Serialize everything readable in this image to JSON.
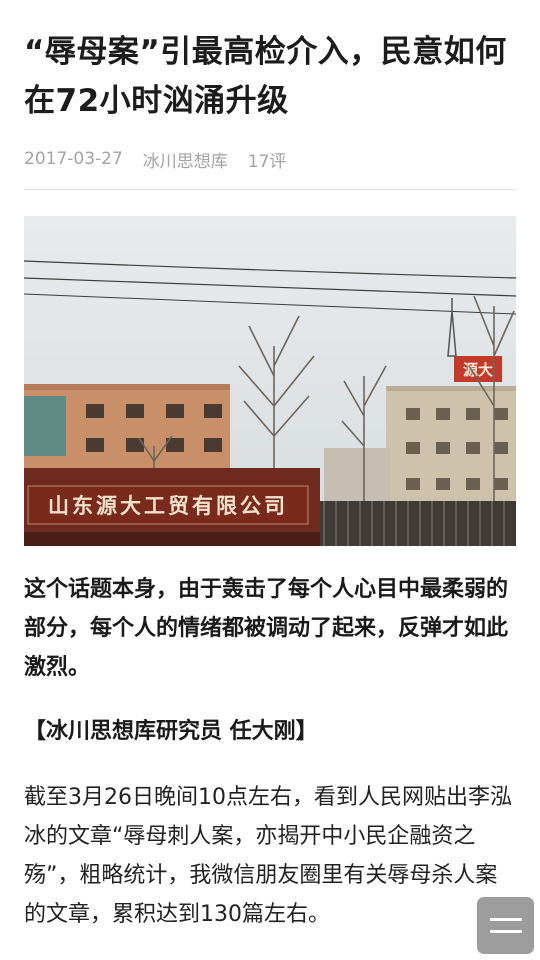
{
  "article": {
    "title": "“辱母案”引最高检介入，民意如何在72小时汹涌升级",
    "date": "2017-03-27",
    "source": "冰川思想库",
    "comments": "17评"
  },
  "photo": {
    "sign_text": "山东源大工贸有限公司",
    "roof_sign_text": "源大"
  },
  "lead": "这个话题本身，由于轰击了每个人心目中最柔弱的部分，每个人的情绪都被调动了起来，反弹才如此激烈。",
  "byline": "【冰川思想库研究员  任大刚】",
  "body": "截至3月26日晚间10点左右，看到人民网贴出李泓冰的文章“辱母刺人案，亦揭开中小民企融资之殇”，粗略统计，我微信朋友圈里有关辱母杀人案的文章，累积达到130篇左右。",
  "floating_menu": {
    "icon": "menu-icon"
  },
  "colors": {
    "meta": "#a3a3a3",
    "sign": "#7a2a1c",
    "button": "#8c8c8c"
  }
}
